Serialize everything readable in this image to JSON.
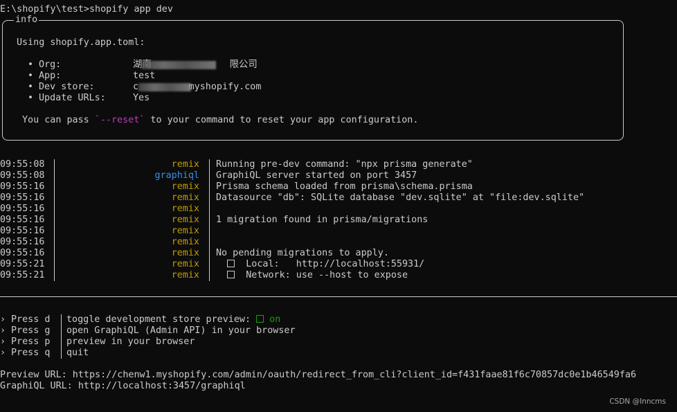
{
  "command_line": "E:\\shopify\\test>shopify app dev",
  "info_box": {
    "label": "info",
    "using_line": "Using shopify.app.toml:",
    "fields": [
      {
        "bullet": "•",
        "key": "Org:",
        "value": "湖南              限公司"
      },
      {
        "bullet": "•",
        "key": "App:",
        "value": "test"
      },
      {
        "bullet": "•",
        "key": "Dev store:",
        "value": "c         myshopify.com"
      },
      {
        "bullet": "•",
        "key": "Update URLs:",
        "value": "Yes"
      }
    ],
    "reset_prefix": "You can pass ",
    "reset_code": "`--reset`",
    "reset_suffix": " to your command to reset your app configuration."
  },
  "logs": [
    {
      "time": "09:55:08",
      "source": "remix",
      "message": "Running pre-dev command: \"npx prisma generate\""
    },
    {
      "time": "09:55:08",
      "source": "graphiql",
      "message": "GraphiQL server started on port 3457"
    },
    {
      "time": "09:55:16",
      "source": "remix",
      "message": "Prisma schema loaded from prisma\\schema.prisma"
    },
    {
      "time": "09:55:16",
      "source": "remix",
      "message": "Datasource \"db\": SQLite database \"dev.sqlite\" at \"file:dev.sqlite\""
    },
    {
      "time": "09:55:16",
      "source": "remix",
      "message": ""
    },
    {
      "time": "09:55:16",
      "source": "remix",
      "message": "1 migration found in prisma/migrations"
    },
    {
      "time": "09:55:16",
      "source": "remix",
      "message": ""
    },
    {
      "time": "09:55:16",
      "source": "remix",
      "message": ""
    },
    {
      "time": "09:55:16",
      "source": "remix",
      "message": "No pending migrations to apply."
    },
    {
      "time": "09:55:21",
      "source": "remix",
      "message": "  Local:   http://localhost:55931/",
      "checkbox": true
    },
    {
      "time": "09:55:21",
      "source": "remix",
      "message": "  Network: use --host to expose",
      "checkbox": true
    }
  ],
  "shortcuts": [
    {
      "arrow": "›",
      "key": "Press d",
      "action": "toggle development store preview: ",
      "status": "on"
    },
    {
      "arrow": "›",
      "key": "Press g",
      "action": "open GraphiQL (Admin API) in your browser"
    },
    {
      "arrow": "›",
      "key": "Press p",
      "action": "preview in your browser"
    },
    {
      "arrow": "›",
      "key": "Press q",
      "action": "quit"
    }
  ],
  "preview_url_line": "Preview URL: https://chenw1.myshopify.com/admin/oauth/redirect_from_cli?client_id=f431faae81f6c70857dc0e1b46549fa6",
  "graphiql_url_line": "GraphiQL URL: http://localhost:3457/graphiql",
  "watermark": "CSDN @Inncms",
  "colors": {
    "background": "#0c0c0c",
    "text": "#cccccc",
    "remix": "#c19c00",
    "graphiql": "#3b8eea",
    "green": "#13a10e",
    "magenta": "#c039c0"
  }
}
